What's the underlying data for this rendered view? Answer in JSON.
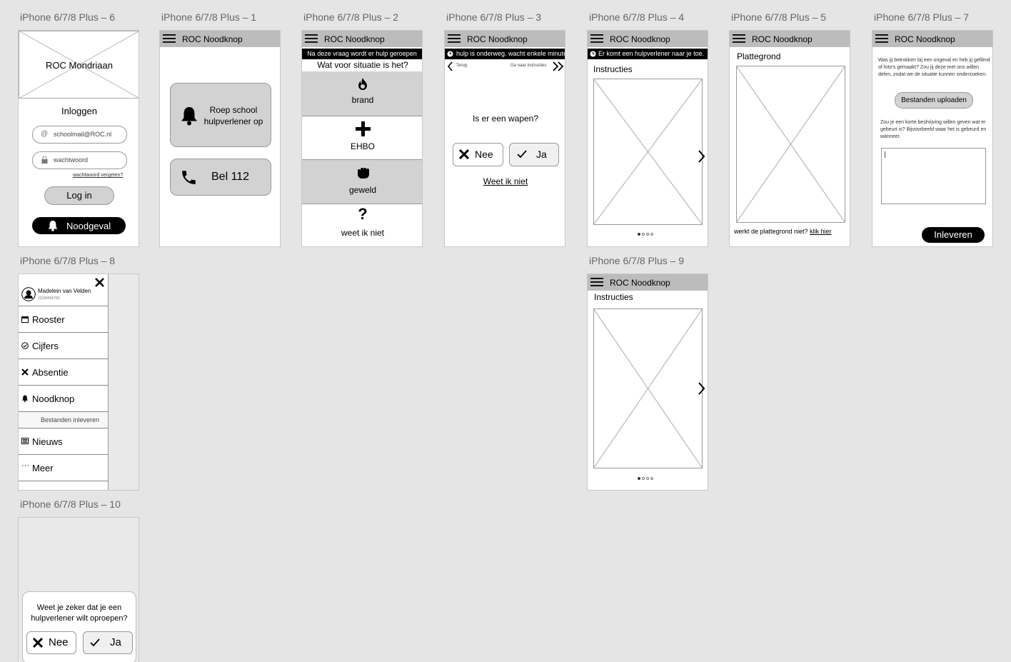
{
  "labels": {
    "a6": "iPhone 6/7/8 Plus – 6",
    "a1": "iPhone 6/7/8 Plus – 1",
    "a2": "iPhone 6/7/8 Plus – 2",
    "a3": "iPhone 6/7/8 Plus – 3",
    "a4": "iPhone 6/7/8 Plus – 4",
    "a5": "iPhone 6/7/8 Plus – 5",
    "a7": "iPhone 6/7/8 Plus – 7",
    "a8": "iPhone 6/7/8 Plus – 8",
    "a9": "iPhone 6/7/8 Plus – 9",
    "a10": "iPhone 6/7/8 Plus – 10"
  },
  "app_title": "ROC Noodknop",
  "login": {
    "school": "ROC Mondriaan",
    "heading": "Inloggen",
    "email_placeholder": "schoolmail@ROC.nl",
    "password_placeholder": "wachtwoord",
    "forgot": "wachtwoord vergeten?",
    "login_button": "Log in",
    "emergency_button": "Noodgeval"
  },
  "screen1": {
    "call_school": "Roep school hulpverlener op",
    "call_112": "Bel 112"
  },
  "screen2": {
    "banner": "Na deze vraag wordt er hulp geroepen",
    "question": "Wat voor situatie is het?",
    "options": [
      "brand",
      "EHBO",
      "geweld",
      "weet ik niet"
    ]
  },
  "screen3": {
    "banner": "hulp is onderweg. wacht enkele minuten",
    "back": "Terug",
    "forward": "Ga naar instructies",
    "question": "Is er een wapen?",
    "no": "Nee",
    "yes": "Ja",
    "dont_know": "Weet ik niet"
  },
  "screen4": {
    "banner": "Er komt een hulpverlener naar je toe.",
    "heading": "Instructies"
  },
  "screen5": {
    "heading": "Plattegrond",
    "footer": "werkt de plattegrond niet?",
    "footer_link": "klik hier"
  },
  "screen7": {
    "intro": "Was jij betrokken bij een ongeval en heb jij gefilmd of foto's gemaakt? Zou jij deze met ons willen delen, zodat we de situatie kunnen onderzoeken.",
    "upload_button": "Bestanden uploaden",
    "prompt": "Zou je een korte beshrijving willen geven wat er gebeurt is? Bijvoorbeeld waar het is gebeurd en wanneer.",
    "submit_button": "Inleveren"
  },
  "screen8": {
    "user_name": "Madelein van Velden",
    "user_id": "12345556789",
    "items": [
      "Rooster",
      "Cijfers",
      "Absentie",
      "Noodknop",
      "Bestanden inleveren",
      "Nieuws",
      "Meer"
    ]
  },
  "screen9": {
    "heading": "Instructies"
  },
  "screen10": {
    "dialog_text": "Weet je zeker dat je een hulpverlener wilt oproepen?",
    "no": "Nee",
    "yes": "Ja"
  },
  "carousel": {
    "pages": 4,
    "current": 1
  },
  "colors": {
    "background": "#e5e5e5",
    "topbar": "#bcbcbc",
    "button_gray": "#d2d2d2",
    "black": "#000000"
  }
}
